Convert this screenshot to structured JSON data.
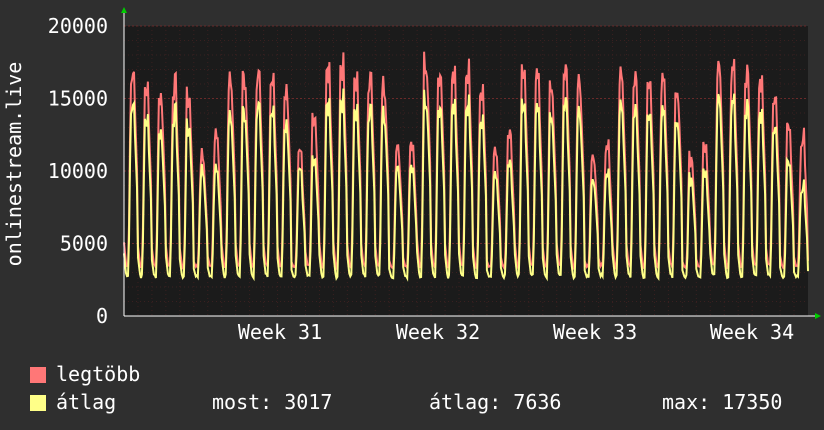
{
  "chart_data": {
    "type": "area",
    "ylabel": "onlinestream.live",
    "ylim": [
      0,
      20000
    ],
    "yticks": [
      0,
      5000,
      10000,
      15000,
      20000
    ],
    "xticks": [
      "Week 31",
      "Week 32",
      "Week 33",
      "Week 34"
    ],
    "colors": {
      "background": "#2f2f2f",
      "plot": "#1b1b1b",
      "grid": "#4a2020",
      "axis_arrow": "#00cc00",
      "max": "#ff7777",
      "avg": "#ffff88"
    },
    "series": [
      {
        "name": "legtöbb",
        "color": "#ff7777",
        "daily_peaks": [
          17900,
          16600,
          16000,
          16800,
          15900,
          11600,
          13300,
          17100,
          17400,
          17600,
          17100,
          16500,
          11500,
          14800,
          17600,
          18200,
          17300,
          17400,
          16900,
          12000,
          12800,
          18700,
          17700,
          17400,
          18000,
          16800,
          11800,
          13000,
          17600,
          17100,
          16300,
          17600,
          16700,
          11800,
          12700,
          17400,
          17100,
          17200,
          17300,
          16600,
          11600,
          12400,
          17700,
          17800,
          17500,
          17200,
          15900,
          13600,
          13100
        ]
      },
      {
        "name": "átlag",
        "color": "#ffff88",
        "daily_peaks": [
          15600,
          14300,
          13400,
          14700,
          13700,
          10500,
          10800,
          14400,
          14900,
          15300,
          14800,
          14000,
          10200,
          11700,
          15100,
          15700,
          15000,
          15100,
          14800,
          10500,
          11100,
          16000,
          15300,
          15100,
          15500,
          14600,
          10100,
          10900,
          15200,
          14700,
          14100,
          15300,
          14500,
          10000,
          10600,
          15100,
          14800,
          14800,
          15000,
          14400,
          10100,
          10500,
          15400,
          15400,
          15100,
          14800,
          13700,
          11000,
          9500
        ]
      }
    ],
    "legend": [
      {
        "name": "legtöbb",
        "color": "#ff7777"
      },
      {
        "name": "átlag",
        "color": "#ffff88"
      }
    ],
    "stats": {
      "most": "most: 3017",
      "atlag": "átlag: 7636",
      "max": "max: 17350"
    }
  }
}
